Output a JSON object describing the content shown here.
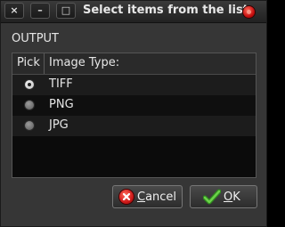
{
  "window": {
    "title": "Select items from the list",
    "controls": {
      "close": "×",
      "minimize": "–",
      "maximize": "□"
    }
  },
  "section": {
    "label": "OUTPUT"
  },
  "list": {
    "columns": [
      "Pick",
      "Image Type:"
    ],
    "rows": [
      {
        "label": "TIFF",
        "selected": true
      },
      {
        "label": "PNG",
        "selected": false
      },
      {
        "label": "JPG",
        "selected": false
      }
    ]
  },
  "buttons": {
    "cancel": {
      "mnemonic": "C",
      "rest": "ancel"
    },
    "ok": {
      "mnemonic": "O",
      "rest": "K"
    }
  },
  "colors": {
    "window_bg": "#363636",
    "list_bg": "#0b0b0b",
    "text": "#e6e6e6",
    "close_red": "#d01a1a",
    "ok_green": "#3ea02a"
  },
  "icons": {
    "title_close": "red-close-orb-icon",
    "cancel": "cancel-icon",
    "ok": "checkmark-icon"
  }
}
